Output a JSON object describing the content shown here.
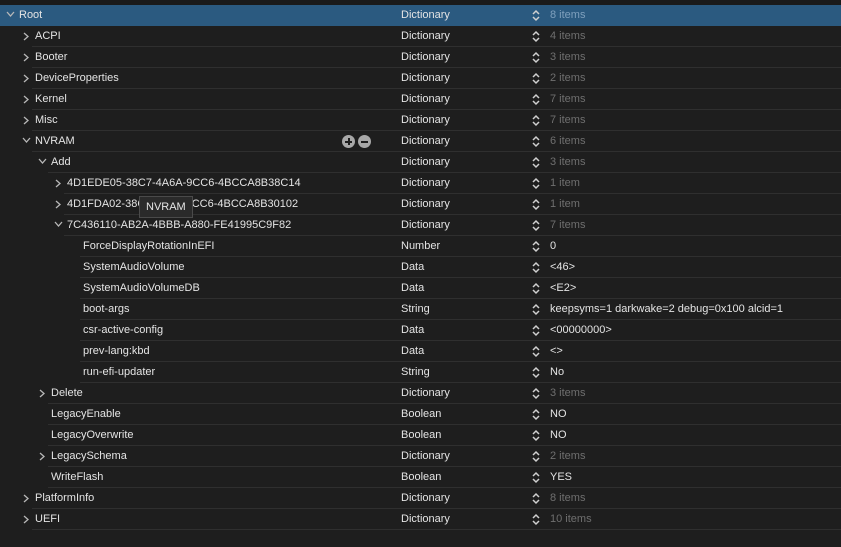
{
  "rows": [
    {
      "key": "Root",
      "level": 0,
      "state": "open",
      "type": "Dictionary",
      "value": "8 items",
      "dim": true,
      "selected": true
    },
    {
      "key": "ACPI",
      "level": 1,
      "state": "closed",
      "type": "Dictionary",
      "value": "4 items",
      "dim": true
    },
    {
      "key": "Booter",
      "level": 1,
      "state": "closed",
      "type": "Dictionary",
      "value": "3 items",
      "dim": true
    },
    {
      "key": "DeviceProperties",
      "level": 1,
      "state": "closed",
      "type": "Dictionary",
      "value": "2 items",
      "dim": true
    },
    {
      "key": "Kernel",
      "level": 1,
      "state": "closed",
      "type": "Dictionary",
      "value": "7 items",
      "dim": true
    },
    {
      "key": "Misc",
      "level": 1,
      "state": "closed",
      "type": "Dictionary",
      "value": "7 items",
      "dim": true
    },
    {
      "key": "NVRAM",
      "level": 1,
      "state": "open",
      "type": "Dictionary",
      "value": "6 items",
      "dim": true,
      "hover": true
    },
    {
      "key": "Add",
      "level": 2,
      "state": "open",
      "type": "Dictionary",
      "value": "3 items",
      "dim": true
    },
    {
      "key": "4D1EDE05-38C7-4A6A-9CC6-4BCCA8B38C14",
      "level": 3,
      "state": "closed",
      "type": "Dictionary",
      "value": "1 item",
      "dim": true
    },
    {
      "key": "4D1FDA02-38C7-4A6A-9CC6-4BCCA8B30102",
      "level": 3,
      "state": "closed",
      "type": "Dictionary",
      "value": "1 item",
      "dim": true
    },
    {
      "key": "7C436110-AB2A-4BBB-A880-FE41995C9F82",
      "level": 3,
      "state": "open",
      "type": "Dictionary",
      "value": "7 items",
      "dim": true
    },
    {
      "key": "ForceDisplayRotationInEFI",
      "level": 4,
      "state": "leaf",
      "type": "Number",
      "value": "0"
    },
    {
      "key": "SystemAudioVolume",
      "level": 4,
      "state": "leaf",
      "type": "Data",
      "value": "<46>"
    },
    {
      "key": "SystemAudioVolumeDB",
      "level": 4,
      "state": "leaf",
      "type": "Data",
      "value": "<E2>"
    },
    {
      "key": "boot-args",
      "level": 4,
      "state": "leaf",
      "type": "String",
      "value": "keepsyms=1 darkwake=2 debug=0x100 alcid=1"
    },
    {
      "key": "csr-active-config",
      "level": 4,
      "state": "leaf",
      "type": "Data",
      "value": "<00000000>"
    },
    {
      "key": "prev-lang:kbd",
      "level": 4,
      "state": "leaf",
      "type": "Data",
      "value": "<>"
    },
    {
      "key": "run-efi-updater",
      "level": 4,
      "state": "leaf",
      "type": "String",
      "value": "No"
    },
    {
      "key": "Delete",
      "level": 2,
      "state": "closed",
      "type": "Dictionary",
      "value": "3 items",
      "dim": true
    },
    {
      "key": "LegacyEnable",
      "level": 2,
      "state": "leaf",
      "type": "Boolean",
      "value": "NO"
    },
    {
      "key": "LegacyOverwrite",
      "level": 2,
      "state": "leaf",
      "type": "Boolean",
      "value": "NO"
    },
    {
      "key": "LegacySchema",
      "level": 2,
      "state": "closed",
      "type": "Dictionary",
      "value": "2 items",
      "dim": true
    },
    {
      "key": "WriteFlash",
      "level": 2,
      "state": "leaf",
      "type": "Boolean",
      "value": "YES"
    },
    {
      "key": "PlatformInfo",
      "level": 1,
      "state": "closed",
      "type": "Dictionary",
      "value": "8 items",
      "dim": true
    },
    {
      "key": "UEFI",
      "level": 1,
      "state": "closed",
      "type": "Dictionary",
      "value": "10 items",
      "dim": true
    }
  ],
  "tooltip": "NVRAM"
}
